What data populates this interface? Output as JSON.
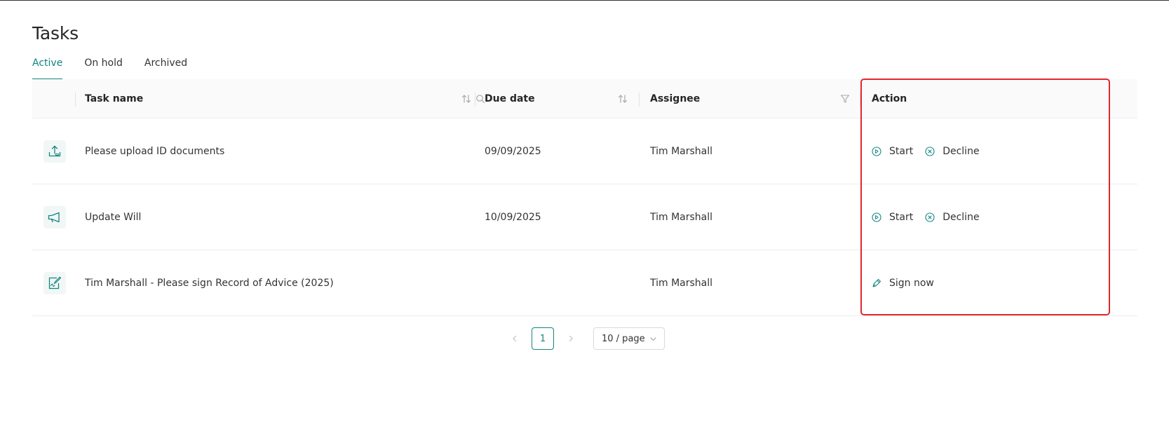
{
  "page": {
    "title": "Tasks"
  },
  "tabs": [
    {
      "label": "Active",
      "active": true
    },
    {
      "label": "On hold",
      "active": false
    },
    {
      "label": "Archived",
      "active": false
    }
  ],
  "table": {
    "columns": {
      "task_name": "Task name",
      "due_date": "Due date",
      "assignee": "Assignee",
      "action": "Action"
    },
    "rows": [
      {
        "icon": "upload-icon",
        "task_name": "Please upload ID documents",
        "due_date": "09/09/2025",
        "assignee": "Tim Marshall",
        "actions": [
          "Start",
          "Decline"
        ]
      },
      {
        "icon": "megaphone-icon",
        "task_name": "Update Will",
        "due_date": "10/09/2025",
        "assignee": "Tim Marshall",
        "actions": [
          "Start",
          "Decline"
        ]
      },
      {
        "icon": "sign-document-icon",
        "task_name": "Tim Marshall - Please sign Record of Advice (2025)",
        "due_date": "",
        "assignee": "Tim Marshall",
        "actions": [
          "Sign now"
        ]
      }
    ]
  },
  "pagination": {
    "current_page": "1",
    "page_size": "10 / page"
  },
  "colors": {
    "accent": "#138580",
    "highlight": "#e0282e"
  }
}
